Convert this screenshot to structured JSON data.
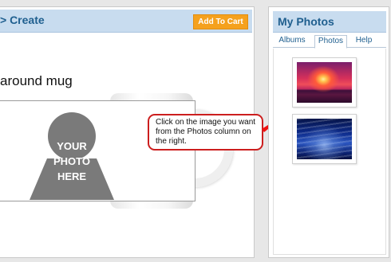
{
  "left_panel": {
    "title": "> Create",
    "add_to_cart_label": "Add To Cart",
    "product_title": "around mug",
    "placeholder_text": "YOUR\nPHOTO\nHERE"
  },
  "tooltip": {
    "text": "Click on the image you want from the Photos column on the right."
  },
  "right_panel": {
    "title": "My Photos",
    "tabs": [
      {
        "label": "Albums",
        "active": false
      },
      {
        "label": "Photos",
        "active": true
      },
      {
        "label": "Help",
        "active": false
      }
    ],
    "photos": [
      {
        "subject": "sunset"
      },
      {
        "subject": "ocean-waves"
      }
    ]
  },
  "colors": {
    "header_bg": "#c8dcef",
    "header_text": "#1f5f8f",
    "add_to_cart_bg": "#f5a11d",
    "tooltip_border": "#cc1e1e",
    "arrow": "#ee1111",
    "placeholder_gray": "#7a7a7a"
  },
  "icons": {
    "arrow": "pointer-arrow-icon",
    "placeholder": "person-silhouette-icon"
  }
}
